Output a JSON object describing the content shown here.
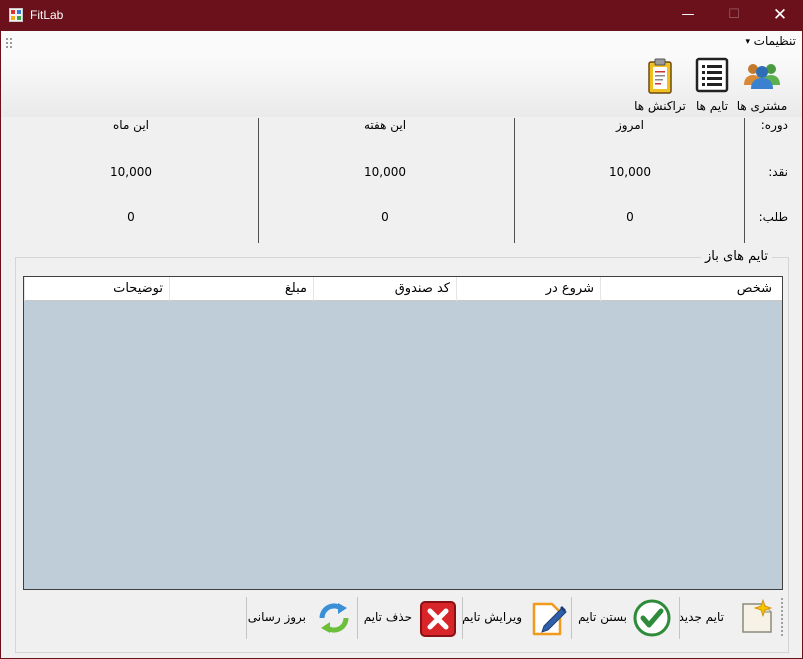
{
  "window": {
    "title": "FitLab",
    "minimize_glyph": "—",
    "maximize_glyph": "☐",
    "close_glyph": "✕",
    "accent": "#6b111b"
  },
  "menu": {
    "settings_label": "تنظیمات",
    "arrow": "▾"
  },
  "toolbar": {
    "customers_label": "مشتری ها",
    "times_label": "تایم ها",
    "transactions_label": "تراکنش ها"
  },
  "stats": {
    "period_label": "دوره:",
    "cash_label": "نقد:",
    "debt_label": "طلب:",
    "columns": [
      {
        "title": "امروز",
        "cash": "10,000",
        "debt": "0"
      },
      {
        "title": "این هفته",
        "cash": "10,000",
        "debt": "0"
      },
      {
        "title": "این ماه",
        "cash": "10,000",
        "debt": "0"
      }
    ]
  },
  "open_times": {
    "title": "تایم های باز",
    "columns": [
      "شخص",
      "شروع در",
      "کد صندوق",
      "مبلغ",
      "توضیحات"
    ],
    "grid_background": "#bfcdd9"
  },
  "actions": {
    "new_time": "تایم جدید",
    "close_time": "بستن تایم",
    "edit_time": "ویرایش تایم",
    "delete_time": "حذف تایم",
    "refresh": "بروز رسانی"
  }
}
